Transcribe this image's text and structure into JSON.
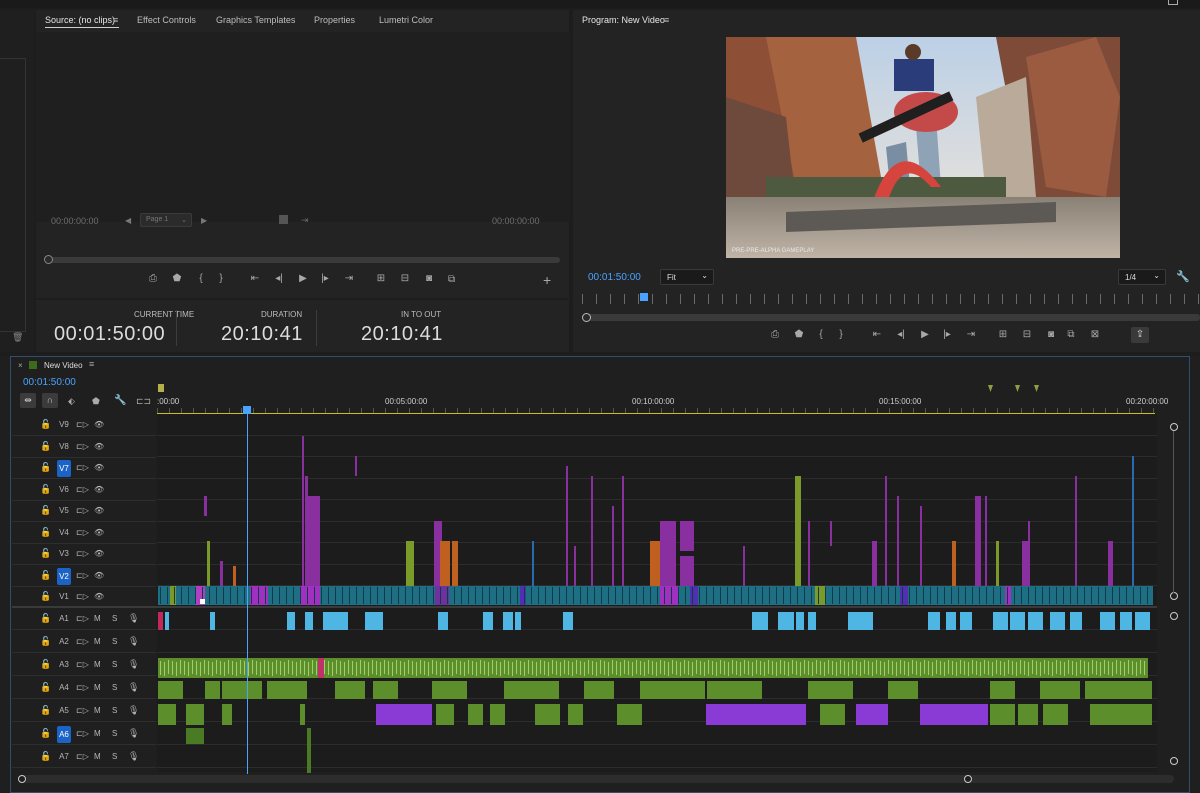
{
  "source_panel": {
    "tabs": [
      "Source: (no clips)",
      "Effect Controls",
      "Graphics Templates",
      "Properties",
      "Lumetri Color"
    ],
    "tc_left": "00:00:00:00",
    "tc_right": "00:00:00:00",
    "page_select": "Page 1"
  },
  "info_panel": {
    "current_time_label": "CURRENT TIME",
    "current_time": "00:01:50:00",
    "duration_label": "DURATION",
    "duration": "20:10:41",
    "in_out_label": "IN TO OUT",
    "in_out": "20:10:41"
  },
  "program_panel": {
    "title": "Program: New Video",
    "timecode": "00:01:50:00",
    "fit": "Fit",
    "resolution": "1/4",
    "watermark": "PRE-PRE-ALPHA GAMEPLAY"
  },
  "timeline": {
    "tab_title": "New Video",
    "timecode": "00:01:50:00",
    "ruler_labels": [
      ":00:00",
      "00:05:00:00",
      "00:10:00:00",
      "00:15:00:00",
      "00:20:00:00"
    ],
    "video_tracks": [
      "V9",
      "V8",
      "V7",
      "V6",
      "V5",
      "V4",
      "V3",
      "V2",
      "V1"
    ],
    "audio_tracks": [
      "A1",
      "A2",
      "A3",
      "A4",
      "A5",
      "A6",
      "A7"
    ],
    "selected_tracks": [
      "V7",
      "V2",
      "A6"
    ],
    "audio_m": "M",
    "audio_s": "S"
  },
  "colors": {
    "accent_blue": "#4aa3ff",
    "purple_clip": "#8a2fa0",
    "teal_clip": "#1f6f84",
    "green_audio": "#5c8f2c",
    "light_blue_audio": "#4fb6e3",
    "violet_audio": "#8a3bd6"
  }
}
